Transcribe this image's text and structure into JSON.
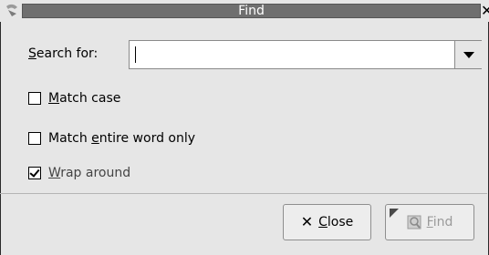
{
  "window": {
    "title": "Find",
    "close_glyph": "✕"
  },
  "search": {
    "label_first": "S",
    "label_rest": "earch for:",
    "value": ""
  },
  "options": [
    {
      "label_pre": "",
      "label_u": "M",
      "label_post": "atch case",
      "checked": false
    },
    {
      "label_pre": "Match ",
      "label_u": "e",
      "label_post": "ntire word only",
      "checked": false
    },
    {
      "label_pre": "",
      "label_u": "W",
      "label_post": "rap around",
      "checked": true
    }
  ],
  "buttons": {
    "close": {
      "glyph": "✕",
      "label_u": "C",
      "label_rest": "lose"
    },
    "find": {
      "label_u": "F",
      "label_rest": "ind"
    }
  },
  "colors": {
    "titlebar": "#6f6f6f",
    "background": "#e6e6e6"
  },
  "icons": [
    "app-icon",
    "close-icon",
    "dropdown-arrow-icon",
    "find-icon"
  ]
}
